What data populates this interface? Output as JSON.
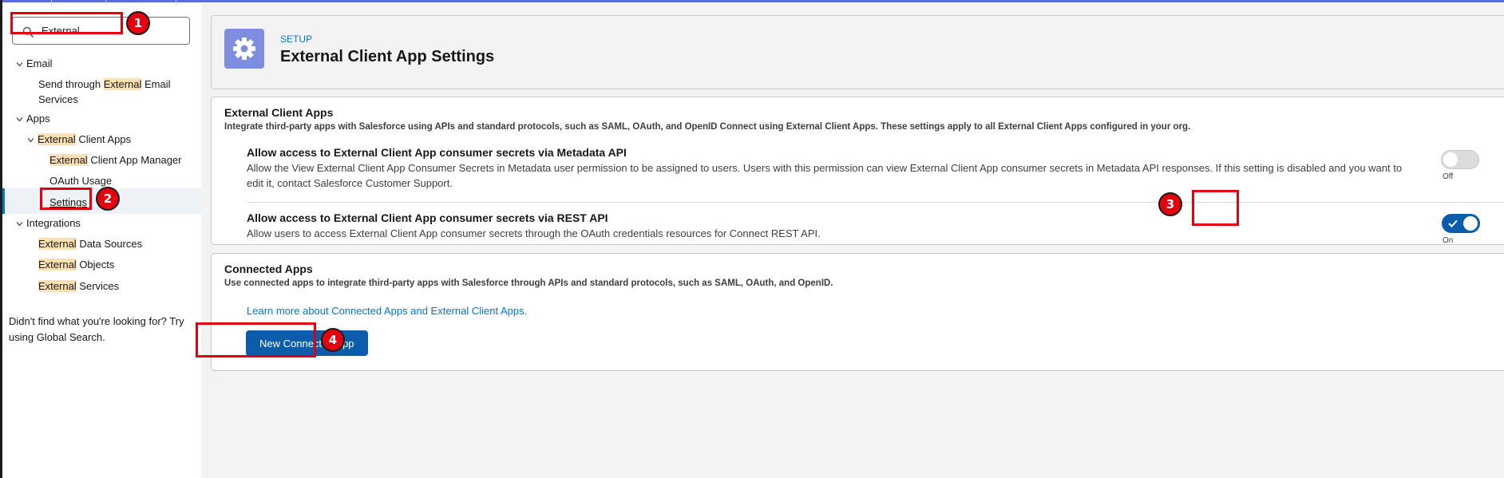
{
  "search": {
    "value": "External"
  },
  "sidebar": {
    "email": {
      "label": "Email",
      "child": {
        "hl": "External",
        "pre": "Send through ",
        "post": " Email",
        "line2": "Services"
      }
    },
    "apps": {
      "label": "Apps",
      "eca": {
        "hl": "External",
        "post": " Client Apps"
      },
      "manager": {
        "hl": "External",
        "post": " Client App Manager"
      },
      "oauth": "OAuth Usage",
      "settings": "Settings"
    },
    "integrations": {
      "label": "Integrations",
      "data_sources": {
        "hl": "External",
        "post": " Data Sources"
      },
      "objects": {
        "hl": "External",
        "post": " Objects"
      },
      "services": {
        "hl": "External",
        "post": " Services"
      }
    },
    "footer_line1": "Didn't find what you're looking for? Try",
    "footer_line2": "using Global Search."
  },
  "header": {
    "eyebrow": "SETUP",
    "title": "External Client App Settings"
  },
  "eca_card": {
    "title": "External Client Apps",
    "desc": "Integrate third-party apps with Salesforce using APIs and standard protocols, such as SAML, OAuth, and OpenID Connect using External Client Apps. These settings apply to all External Client Apps configured in your org.",
    "settings": [
      {
        "title": "Allow access to External Client App consumer secrets via Metadata API",
        "desc_line1": "Allow the View External Client App Consumer Secrets in Metadata user permission to be assigned to users. Users with this permission can view External Client App consumer secrets in Metadata API responses. If this setting is disabled and you want to",
        "desc_line2": "edit it, contact Salesforce Customer Support.",
        "state": "Off"
      },
      {
        "title": "Allow access to External Client App consumer secrets via REST API",
        "desc_line1": "Allow users to access External Client App consumer secrets through the OAuth credentials resources for Connect REST API.",
        "state": "On"
      }
    ]
  },
  "connected_card": {
    "title": "Connected Apps",
    "desc": "Use connected apps to integrate third-party apps with Salesforce through APIs and standard protocols, such as SAML, OAuth, and OpenID.",
    "link": "Learn more about Connected Apps and External Client Apps.",
    "button": "New Connected App"
  },
  "annotations": [
    "1",
    "2",
    "3",
    "4"
  ],
  "colors": {
    "brand": "#0b5cab",
    "link": "#0176d3",
    "annotation": "#e3000f",
    "highlight": "#fbe0b3"
  },
  "icons": [
    "search-icon",
    "chevron-down-icon",
    "gear-icon",
    "checkmark-icon"
  ]
}
